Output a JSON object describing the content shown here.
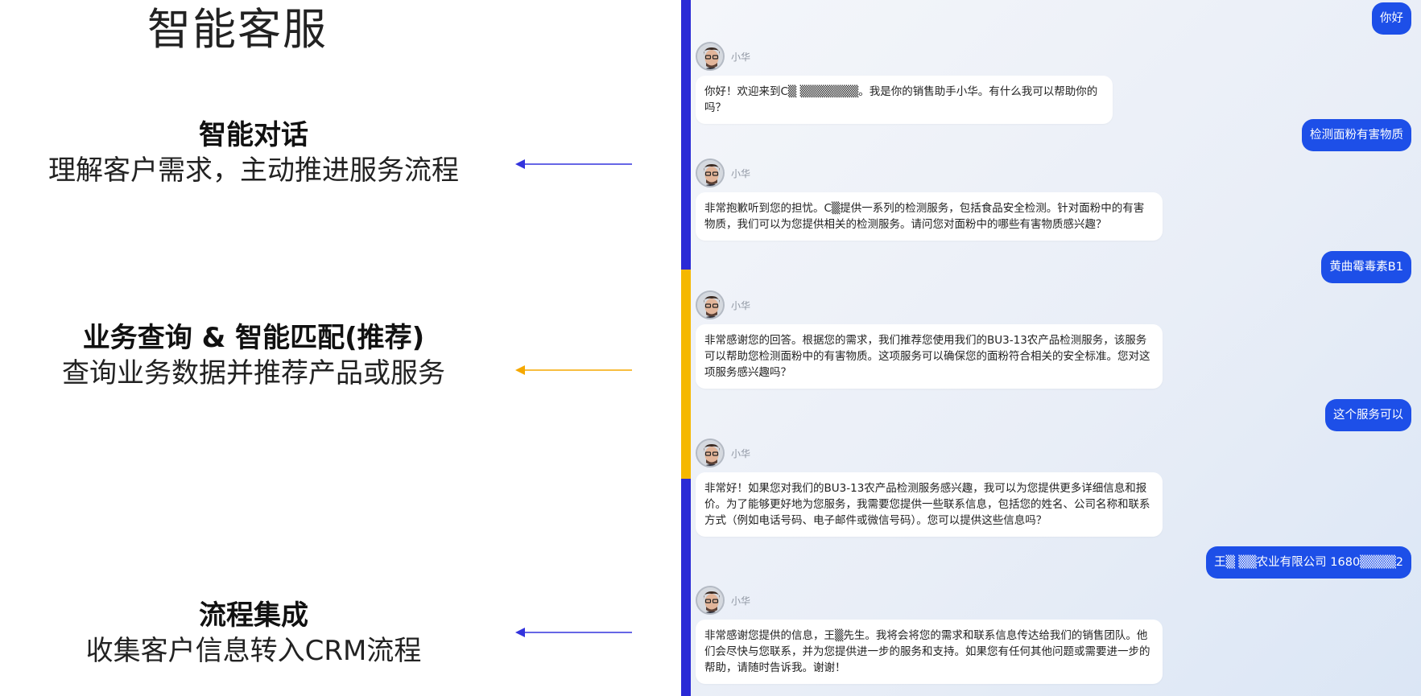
{
  "page_title": "智能客服",
  "features": [
    {
      "title": "智能对话",
      "desc": "理解客户需求，主动推进服务流程",
      "color": "#3333dd"
    },
    {
      "title": "业务查询 & 智能匹配(推荐)",
      "desc": "查询业务数据并推荐产品或服务",
      "color": "#f5a800"
    },
    {
      "title": "流程集成",
      "desc": "收集客户信息转入CRM流程",
      "color": "#3333dd"
    }
  ],
  "colors": {
    "accent_blue": "#2a2ad6",
    "accent_yellow": "#f5b800",
    "user_bubble": "#1d4fe8"
  },
  "chat": {
    "bot_name": "小华",
    "messages": [
      {
        "role": "user",
        "text": "你好"
      },
      {
        "role": "bot",
        "text": "你好！欢迎来到C▒ ▒▒▒▒▒▒▒。我是你的销售助手小华。有什么我可以帮助你的吗？"
      },
      {
        "role": "user",
        "text": "检测面粉有害物质"
      },
      {
        "role": "bot",
        "text": "非常抱歉听到您的担忧。C▒提供一系列的检测服务，包括食品安全检测。针对面粉中的有害物质，我们可以为您提供相关的检测服务。请问您对面粉中的哪些有害物质感兴趣？"
      },
      {
        "role": "user",
        "text": "黄曲霉毒素B1"
      },
      {
        "role": "bot",
        "text": "非常感谢您的回答。根据您的需求，我们推荐您使用我们的BU3-13农产品检测服务，该服务可以帮助您检测面粉中的有害物质。这项服务可以确保您的面粉符合相关的安全标准。您对这项服务感兴趣吗？"
      },
      {
        "role": "user",
        "text": "这个服务可以"
      },
      {
        "role": "bot",
        "text": "非常好！如果您对我们的BU3-13农产品检测服务感兴趣，我可以为您提供更多详细信息和报价。为了能够更好地为您服务，我需要您提供一些联系信息，包括您的姓名、公司名称和联系方式（例如电话号码、电子邮件或微信号码）。您可以提供这些信息吗？"
      },
      {
        "role": "user",
        "text": "王▒ ▒▒农业有限公司 1680▒▒▒▒2"
      },
      {
        "role": "bot",
        "text": "非常感谢您提供的信息，王▒先生。我将会将您的需求和联系信息传达给我们的销售团队。他们会尽快与您联系，并为您提供进一步的服务和支持。如果您有任何其他问题或需要进一步的帮助，请随时告诉我。谢谢！"
      }
    ]
  }
}
